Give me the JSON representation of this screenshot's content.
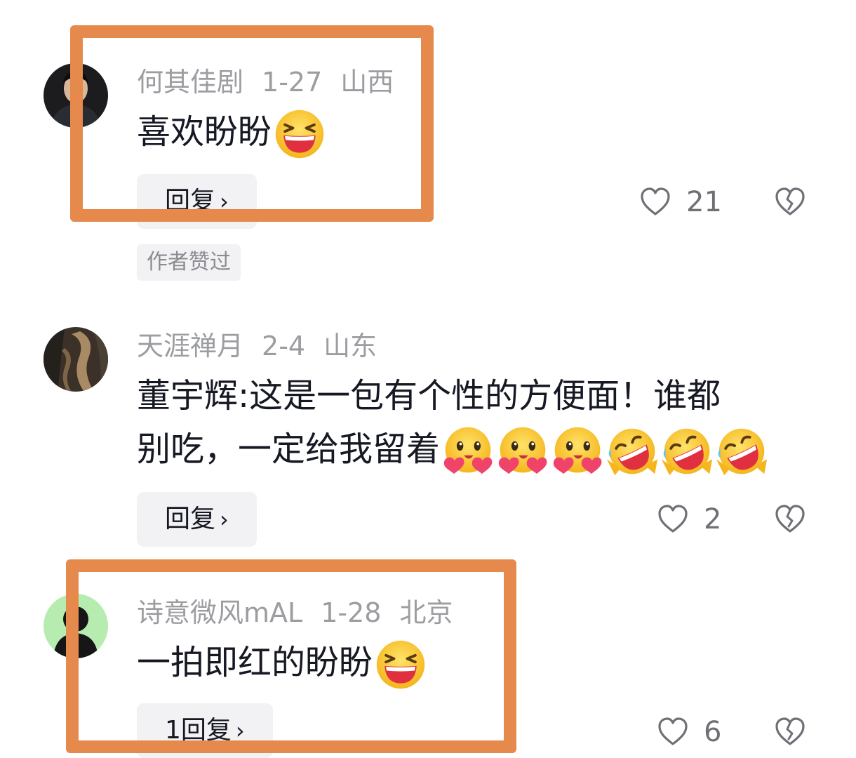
{
  "comments": [
    {
      "username": "何其佳剧",
      "date": "1-27",
      "location": "山西",
      "text": "喜欢盼盼",
      "emojis": [
        "grinning-squint-emoji"
      ],
      "reply_label": "回复",
      "author_liked": "作者赞过",
      "likes": "21"
    },
    {
      "username": "天涯禅月",
      "date": "2-4",
      "location": "山东",
      "text_line1": "董宇辉:这是一包有个性的方便面！谁都",
      "text_line2": "别吃，一定给我留着",
      "emojis": [
        "hugging-emoji",
        "hugging-emoji",
        "hugging-emoji",
        "rolling-laughing-emoji",
        "rolling-laughing-emoji",
        "rolling-laughing-emoji"
      ],
      "reply_label": "回复",
      "likes": "2"
    },
    {
      "username": "诗意微风mAL",
      "date": "1-28",
      "location": "北京",
      "text": "一拍即红的盼盼",
      "emojis": [
        "grinning-squint-emoji"
      ],
      "reply_label": "1回复",
      "likes": "6"
    }
  ],
  "colors": {
    "highlight": "#e5894d",
    "meta_text": "#9c9da1",
    "body_text": "#161823",
    "button_bg": "#f2f2f4"
  }
}
